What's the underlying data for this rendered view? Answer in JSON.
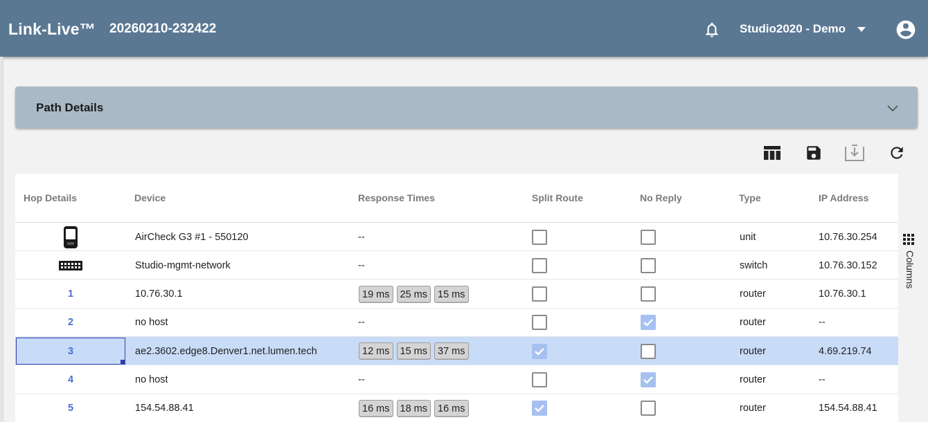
{
  "header": {
    "brand": "Link-Live™",
    "session": "20260210-232422",
    "org": "Studio2020 - Demo"
  },
  "panel": {
    "title": "Path Details"
  },
  "toolbar": {
    "icons": [
      "table-columns-icon",
      "save-icon",
      "download-icon",
      "refresh-icon"
    ]
  },
  "grid": {
    "columns": [
      "Hop Details",
      "Device",
      "Response Times",
      "Split Route",
      "No Reply",
      "Type",
      "IP Address"
    ],
    "rows": [
      {
        "hop": "",
        "hop_icon": "handheld-device-icon",
        "device": "AirCheck G3 #1 - 550120",
        "response_text": "--",
        "response_chips": [],
        "split_route": false,
        "no_reply": false,
        "type": "unit",
        "ip": "10.76.30.254",
        "selected": false
      },
      {
        "hop": "",
        "hop_icon": "network-switch-icon",
        "device": "Studio-mgmt-network",
        "response_text": "--",
        "response_chips": [],
        "split_route": false,
        "no_reply": false,
        "type": "switch",
        "ip": "10.76.30.152",
        "selected": false
      },
      {
        "hop": "1",
        "hop_icon": "",
        "device": "10.76.30.1",
        "response_text": "",
        "response_chips": [
          "19 ms",
          "25 ms",
          "15 ms"
        ],
        "split_route": false,
        "no_reply": false,
        "type": "router",
        "ip": "10.76.30.1",
        "selected": false
      },
      {
        "hop": "2",
        "hop_icon": "",
        "device": "no host",
        "response_text": "--",
        "response_chips": [],
        "split_route": false,
        "no_reply": true,
        "type": "router",
        "ip": "--",
        "selected": false
      },
      {
        "hop": "3",
        "hop_icon": "",
        "device": "ae2.3602.edge8.Denver1.net.lumen.tech",
        "response_text": "",
        "response_chips": [
          "12 ms",
          "15 ms",
          "37 ms"
        ],
        "split_route": true,
        "no_reply": false,
        "type": "router",
        "ip": "4.69.219.74",
        "selected": true
      },
      {
        "hop": "4",
        "hop_icon": "",
        "device": "no host",
        "response_text": "--",
        "response_chips": [],
        "split_route": false,
        "no_reply": true,
        "type": "router",
        "ip": "--",
        "selected": false
      },
      {
        "hop": "5",
        "hop_icon": "",
        "device": "154.54.88.41",
        "response_text": "",
        "response_chips": [
          "16 ms",
          "18 ms",
          "16 ms"
        ],
        "split_route": true,
        "no_reply": false,
        "type": "router",
        "ip": "154.54.88.41",
        "selected": false
      }
    ]
  },
  "side_panel": {
    "columns_label": "Columns"
  },
  "colors": {
    "topbar": "#5b7893",
    "panel": "#a9bac6",
    "selected_row": "#c8dcf8",
    "link": "#4a6fd4",
    "checked": "#a6c1f0"
  }
}
